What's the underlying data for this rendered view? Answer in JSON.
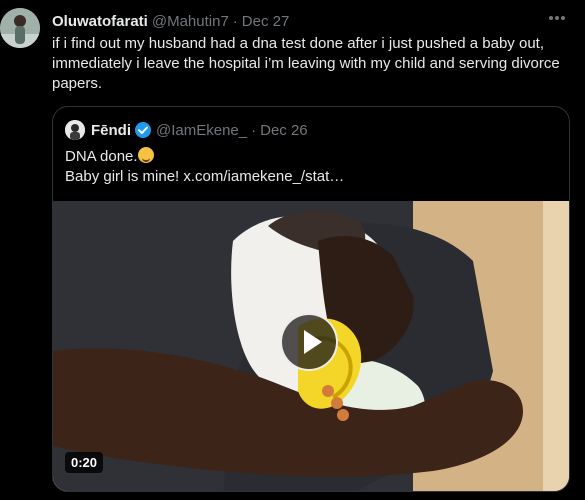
{
  "tweet": {
    "author_name": "Oluwatofarati",
    "handle": "@Mahutin7",
    "separator": "·",
    "date": "Dec 27",
    "text": "if i find out my husband had a dna test done after i just pushed a baby out, immediately i leave the hospital i’m leaving with my child and serving divorce papers."
  },
  "quoted_tweet": {
    "author_name": "Fēndi",
    "handle": "@IamEkene_",
    "separator": "·",
    "date": "Dec 26",
    "line1": "DNA done.",
    "line2": "Baby girl is mine!  x.com/iamekene_/stat…",
    "video_duration": "0:20"
  },
  "icons": {
    "more": "more-horizontal-icon",
    "verified": "verified-badge-icon",
    "play": "play-icon",
    "emoji": "grinning-sweat-emoji"
  },
  "colors": {
    "background": "#000000",
    "text": "#e7e9ea",
    "secondary": "#71767b",
    "verified": "#1d9bf0",
    "border": "#2f3336"
  }
}
